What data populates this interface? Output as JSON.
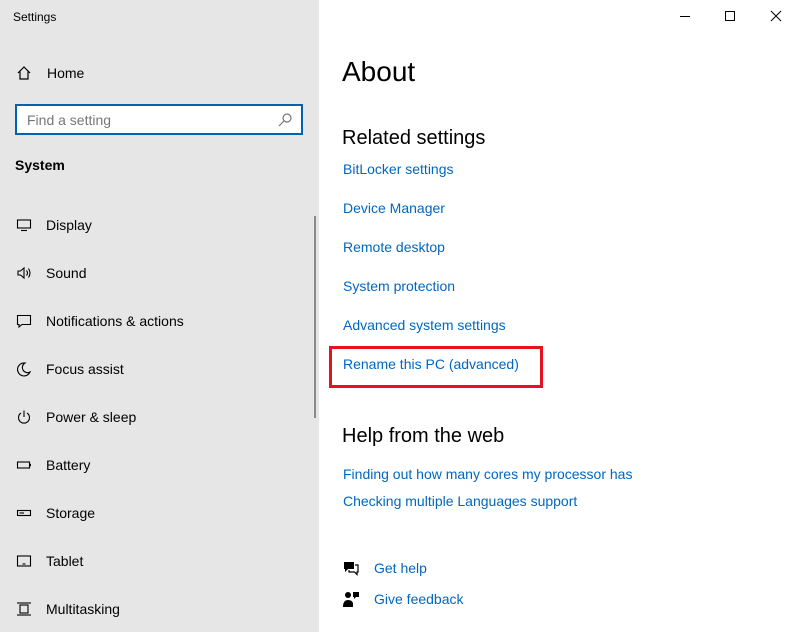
{
  "window": {
    "title": "Settings"
  },
  "sidebar": {
    "home_label": "Home",
    "search_placeholder": "Find a setting",
    "section_title": "System",
    "items": [
      {
        "label": "Display",
        "icon": "display-icon"
      },
      {
        "label": "Sound",
        "icon": "sound-icon"
      },
      {
        "label": "Notifications & actions",
        "icon": "notifications-icon"
      },
      {
        "label": "Focus assist",
        "icon": "focus-assist-icon"
      },
      {
        "label": "Power & sleep",
        "icon": "power-icon"
      },
      {
        "label": "Battery",
        "icon": "battery-icon"
      },
      {
        "label": "Storage",
        "icon": "storage-icon"
      },
      {
        "label": "Tablet",
        "icon": "tablet-icon"
      },
      {
        "label": "Multitasking",
        "icon": "multitasking-icon"
      }
    ]
  },
  "main": {
    "title": "About",
    "related": {
      "heading": "Related settings",
      "links": [
        "BitLocker settings",
        "Device Manager",
        "Remote desktop",
        "System protection",
        "Advanced system settings",
        "Rename this PC (advanced)"
      ]
    },
    "help_web": {
      "heading": "Help from the web",
      "links": [
        "Finding out how many cores my processor has",
        "Checking multiple Languages support"
      ]
    },
    "get_help": "Get help",
    "give_feedback": "Give feedback"
  },
  "colors": {
    "accent": "#0067c0",
    "highlight": "#e81123",
    "sidebar_bg": "#e6e6e6"
  }
}
